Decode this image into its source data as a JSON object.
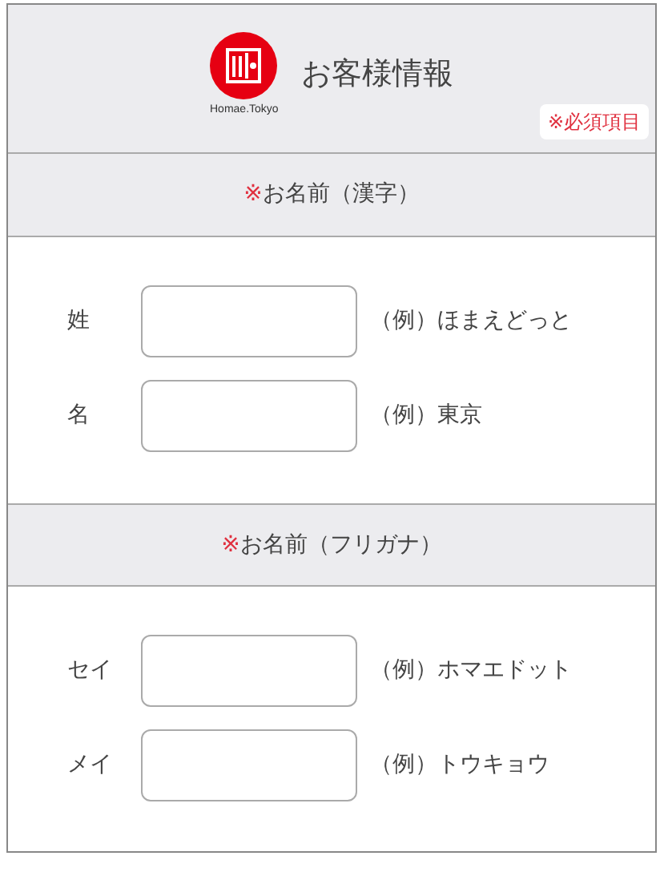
{
  "header": {
    "logo_text": "Homae.Tokyo",
    "title": "お客様情報",
    "required_badge": "※必須項目"
  },
  "sections": [
    {
      "mark": "※",
      "title": "お名前（漢字）",
      "fields": [
        {
          "label": "姓",
          "example": "（例）ほまえどっと"
        },
        {
          "label": "名",
          "example": "（例）東京"
        }
      ]
    },
    {
      "mark": "※",
      "title": "お名前（フリガナ）",
      "fields": [
        {
          "label": "セイ",
          "example": "（例）ホマエドット"
        },
        {
          "label": "メイ",
          "example": "（例）トウキョウ"
        }
      ]
    }
  ]
}
